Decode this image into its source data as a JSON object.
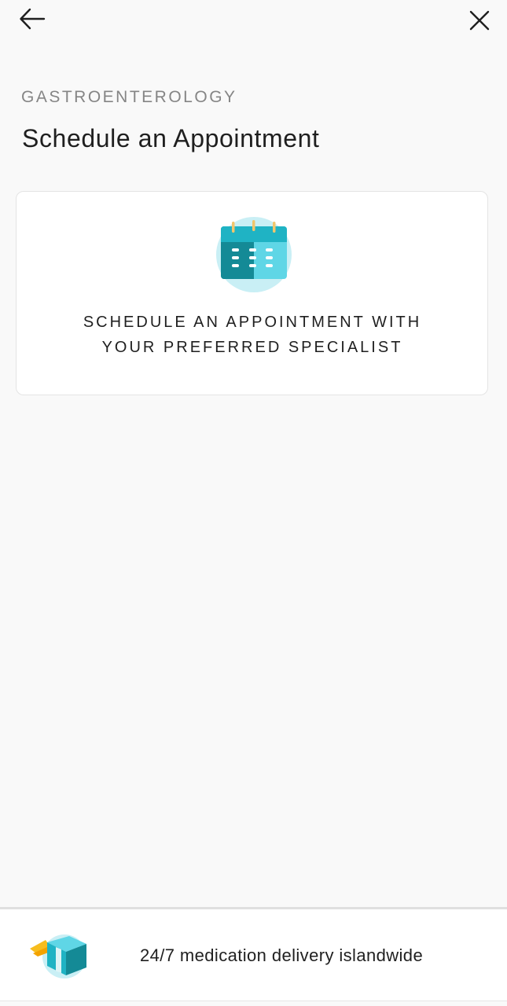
{
  "header": {
    "back_icon": "arrow-left-icon",
    "close_icon": "close-icon"
  },
  "category": "GASTROENTEROLOGY",
  "title": "Schedule an Appointment",
  "card": {
    "icon": "calendar-icon",
    "line1": "SCHEDULE AN APPOINTMENT WITH",
    "line2": "YOUR PREFERRED SPECIALIST"
  },
  "banner": {
    "icon": "delivery-box-icon",
    "text": "24/7 medication delivery islandwide"
  },
  "colors": {
    "background": "#f9f9f9",
    "teal_dark": "#148a96",
    "teal_light": "#5fd6e6",
    "teal_circle": "#c9eff5",
    "ring_yellow": "#f2c66b",
    "wing_yellow": "#f7bd1e"
  }
}
